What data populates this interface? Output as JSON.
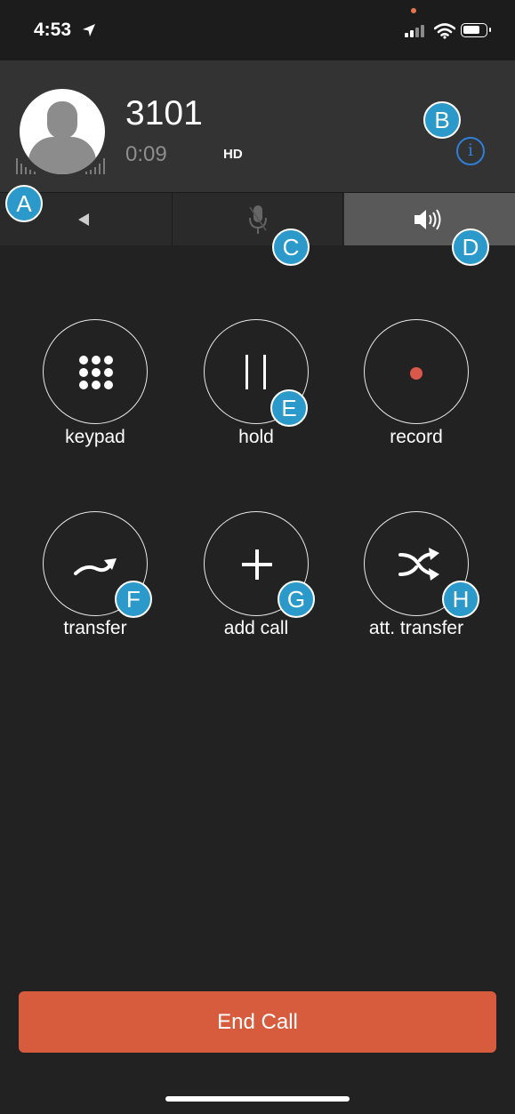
{
  "status_bar": {
    "time": "4:53"
  },
  "call": {
    "number": "3101",
    "duration": "0:09",
    "quality_badge": "HD",
    "info_icon": "i"
  },
  "tabs": [
    {
      "name": "back",
      "icon": "triangle-left-icon"
    },
    {
      "name": "mute",
      "icon": "microphone-icon",
      "active": false
    },
    {
      "name": "speaker",
      "icon": "speaker-icon",
      "active": true
    }
  ],
  "actions": [
    {
      "label": "keypad",
      "icon": "keypad-icon"
    },
    {
      "label": "hold",
      "icon": "pause-icon"
    },
    {
      "label": "record",
      "icon": "record-icon"
    },
    {
      "label": "transfer",
      "icon": "transfer-arrow-icon"
    },
    {
      "label": "add call",
      "icon": "plus-icon"
    },
    {
      "label": "att. transfer",
      "icon": "shuffle-icon"
    }
  ],
  "badges": {
    "a": "A",
    "b": "B",
    "c": "C",
    "d": "D",
    "e": "E",
    "f": "F",
    "g": "G",
    "h": "H"
  },
  "end_call": {
    "label": "End Call"
  },
  "colors": {
    "background": "#222222",
    "header": "#333333",
    "end_call": "#d75c3e",
    "badge": "#2b99c9",
    "info": "#2f7fd8",
    "record_dot": "#d9574b",
    "speaker_active": "#595959"
  }
}
